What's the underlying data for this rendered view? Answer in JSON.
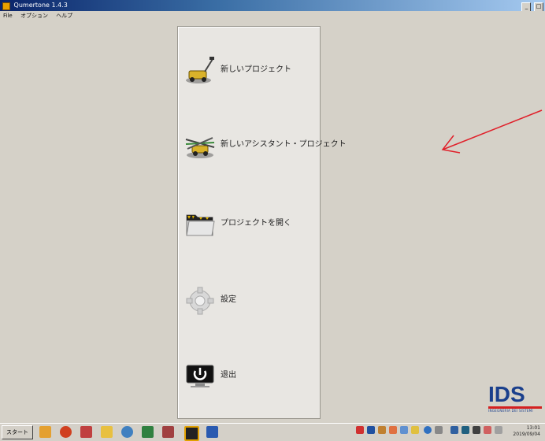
{
  "window": {
    "title": "Qumertone 1.4.3",
    "btn_min": "_",
    "btn_max": "□"
  },
  "menu": {
    "file": "File",
    "options": "オプション",
    "help": "ヘルプ"
  },
  "panel": {
    "new_project": "新しいプロジェクト",
    "new_assistant_project": "新しいアシスタント・プロジェクト",
    "open_project": "プロジェクトを開く",
    "settings": "設定",
    "exit": "退出"
  },
  "logo": {
    "text": "IDS",
    "sub": "INGEGNERIA DEI SISTEMI"
  },
  "taskbar": {
    "start": "スタート",
    "clock_time": "13:01",
    "clock_date": "2019/09/04"
  },
  "colors": {
    "accent_arrow": "#e0202a",
    "brand": "#1a3f8c"
  }
}
